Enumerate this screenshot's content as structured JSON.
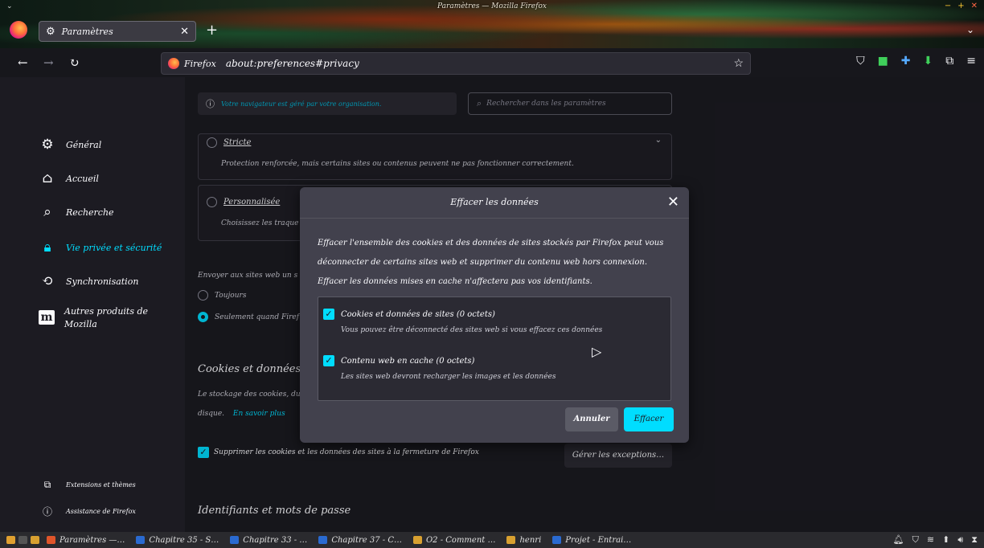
{
  "window": {
    "title": "Paramètres — Mozilla Firefox"
  },
  "tabs": [
    {
      "label": "Paramètres"
    }
  ],
  "urlbar": {
    "brand": "Firefox",
    "url": "about:preferences#privacy"
  },
  "sidebar": {
    "items": [
      {
        "label": "Général",
        "icon": "gear-icon"
      },
      {
        "label": "Accueil",
        "icon": "home-icon"
      },
      {
        "label": "Recherche",
        "icon": "search-icon"
      },
      {
        "label": "Vie privée et sécurité",
        "icon": "lock-icon"
      },
      {
        "label": "Synchronisation",
        "icon": "sync-icon"
      },
      {
        "label": "Autres produits de Mozilla",
        "icon": "mozilla-icon"
      }
    ],
    "footer": [
      {
        "label": "Extensions et thèmes",
        "icon": "puzzle-icon"
      },
      {
        "label": "Assistance de Firefox",
        "icon": "help-icon"
      }
    ]
  },
  "main": {
    "managed_notice": "Votre navigateur est géré par votre organisation.",
    "search_placeholder": "Rechercher dans les paramètres",
    "strict": {
      "title": "Stricte",
      "desc": "Protection renforcée, mais certains sites ou contenus peuvent ne pas fonctionner correctement."
    },
    "custom": {
      "title": "Personnalisée",
      "desc": "Choisissez les traque"
    },
    "dnt": {
      "label": "Envoyer aux sites web un s",
      "option_always": "Toujours",
      "option_only": "Seulement quand Firef"
    },
    "cookies": {
      "heading": "Cookies et données de si",
      "desc_line1": "Le stockage des cookies, du",
      "desc_line2": "disque.",
      "learn_more": "En savoir plus",
      "delete_on_close": "Supprimer les cookies et les données des sites à la fermeture de Firefox",
      "manage_exceptions": "Gérer les exceptions…"
    },
    "logins": {
      "heading": "Identifiants et mots de passe"
    }
  },
  "dialog": {
    "title": "Effacer les données",
    "description": "Effacer l'ensemble des cookies et des données de sites stockés par Firefox peut vous déconnecter de certains sites web et supprimer du contenu web hors connexion. Effacer les données mises en cache n'affectera pas vos identifiants.",
    "options": [
      {
        "label": "Cookies et données de sites (0 octets)",
        "desc": "Vous pouvez être déconnecté des sites web si vous effacez ces données",
        "checked": true
      },
      {
        "label": "Contenu web en cache (0 octets)",
        "desc": "Les sites web devront recharger les images et les données",
        "checked": true
      }
    ],
    "cancel_label": "Annuler",
    "clear_label": "Effacer"
  },
  "taskbar": {
    "items": [
      {
        "label": "Paramètres —…",
        "color": "#e0552a"
      },
      {
        "label": "Chapitre 35 - S…",
        "color": "#2a6ad0"
      },
      {
        "label": "Chapitre 33 - …",
        "color": "#2a6ad0"
      },
      {
        "label": "Chapitre 37 - C…",
        "color": "#2a6ad0"
      },
      {
        "label": "O2 - Comment …",
        "color": "#d8a030"
      },
      {
        "label": "henri",
        "color": "#d8a030"
      },
      {
        "label": "Projet - Entrai…",
        "color": "#2a6ad0"
      }
    ]
  },
  "colors": {
    "accent": "#00ddff",
    "background": "#1c1b22",
    "dialog": "#42414d"
  }
}
